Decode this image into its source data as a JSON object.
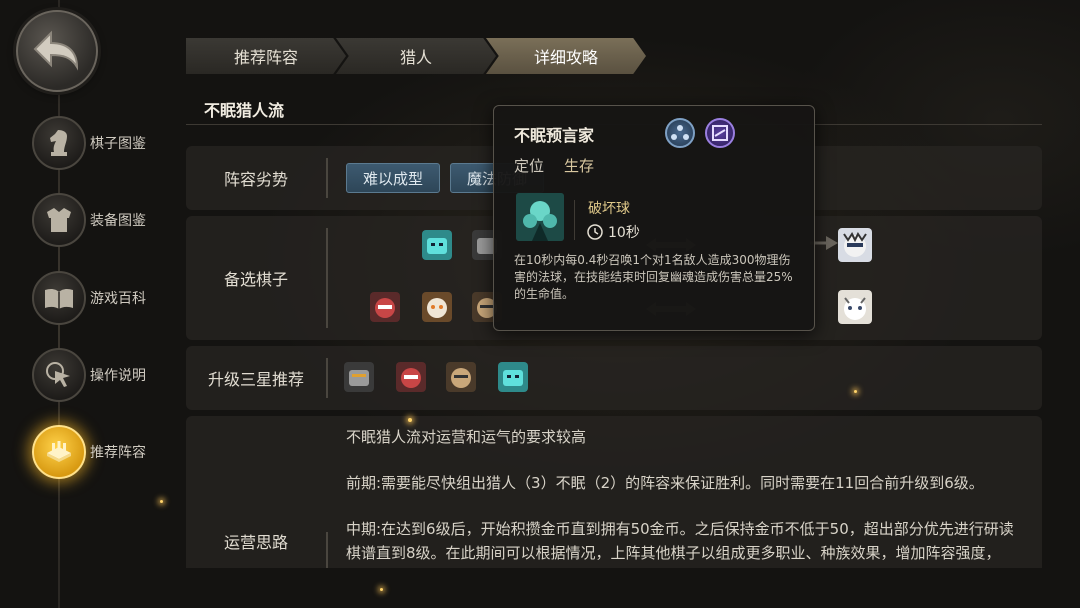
{
  "sidebar": {
    "back_label": "",
    "items": [
      {
        "label": "棋子图鉴",
        "icon": "knight-icon"
      },
      {
        "label": "装备图鉴",
        "icon": "armor-icon"
      },
      {
        "label": "游戏百科",
        "icon": "book-icon"
      },
      {
        "label": "操作说明",
        "icon": "cursor-click-icon"
      },
      {
        "label": "推荐阵容",
        "icon": "chessboard-icon",
        "active": true
      }
    ]
  },
  "breadcrumb": [
    "推荐阵容",
    "猎人",
    "详细攻略"
  ],
  "section_title": "不眠猎人流",
  "rows": {
    "weakness": {
      "label": "阵容劣势",
      "tags": [
        "难以成型",
        "魔法防御"
      ]
    },
    "alternates": {
      "label": "备选棋子"
    },
    "upgrade": {
      "label": "升级三星推荐"
    },
    "strategy": {
      "label": "运营思路",
      "lines": [
        "不眠猎人流对运营和运气的要求较高",
        "前期:需要能尽快组出猎人（3）不眠（2）的阵容来保证胜利。同时需要在11回合前升级到6级。",
        "中期:在达到6级后，开始积攒金币直到拥有50金币。之后保持金币不低于50，超出部分优先进行研读",
        "棋谱直到8级。在此期间可以根据情况，上阵其他棋子以组成更多职业、种族效果，增加阵容强度，"
      ]
    }
  },
  "popup": {
    "title": "不眠预言家",
    "role_label": "定位",
    "role_value": "生存",
    "skill_name": "破坏球",
    "cooldown": "10秒",
    "description": "在10秒内每0.4秒召唤1个对1名敌人造成300物理伤害的法球，在技能结束时回复幽魂造成伤害总量25%的生命值。"
  },
  "colors": {
    "accent_gold": "#f2b420",
    "tag_blue": "#3d5a70",
    "active_crumb": "#7a6f58"
  }
}
